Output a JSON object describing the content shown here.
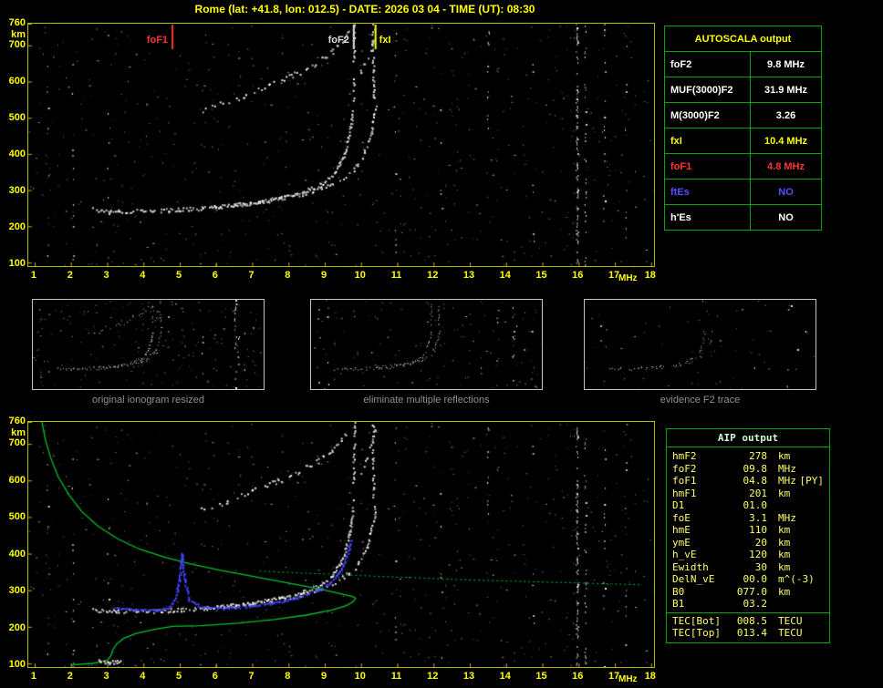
{
  "title": "Rome (lat: +41.8, lon: 012.5) - DATE: 2026 03 04 - TIME (UT): 08:30",
  "colors": {
    "background": "#000000",
    "title": "#ffff00",
    "plot_border": "#b8b800",
    "axis_label": "#ffff00",
    "table_border": "#00aa00",
    "caption_gray": "#909090",
    "thumb_border": "#c4c4c4",
    "profile_green": "#00c030",
    "trace_blue": "#4545ff",
    "marker_red": "#ff3535",
    "marker_white": "#e0e0e0",
    "marker_yellow": "#ffff00",
    "aip_text": "#ffff66",
    "aip_header": "#ccffcc"
  },
  "top_plot": {
    "y_unit": "km",
    "x_unit": "MHz",
    "y_ticks": [
      760,
      700,
      600,
      500,
      400,
      300,
      200,
      100
    ],
    "x_ticks": [
      1,
      2,
      3,
      4,
      5,
      6,
      7,
      8,
      9,
      10,
      11,
      12,
      13,
      14,
      15,
      16,
      17,
      18
    ],
    "markers": [
      {
        "label": "foF1",
        "freq": 4.8,
        "color": "#ff3535",
        "side": "left"
      },
      {
        "label": "foF2",
        "freq": 9.8,
        "color": "#e0e0e0",
        "side": "left"
      },
      {
        "label": "fxI",
        "freq": 10.4,
        "color": "#ffff00",
        "side": "right"
      }
    ]
  },
  "bottom_plot": {
    "y_unit": "km",
    "x_unit": "MHz",
    "y_ticks": [
      760,
      700,
      600,
      500,
      400,
      300,
      200,
      100
    ],
    "x_ticks": [
      1,
      2,
      3,
      4,
      5,
      6,
      7,
      8,
      9,
      10,
      11,
      12,
      13,
      14,
      15,
      16,
      17,
      18
    ]
  },
  "autoscala_table": {
    "header": "AUTOSCALA output",
    "rows": [
      {
        "label": "foF2",
        "value": "9.8 MHz",
        "color": "#ffffff"
      },
      {
        "label": "MUF(3000)F2",
        "value": "31.9 MHz",
        "color": "#ffffff"
      },
      {
        "label": "M(3000)F2",
        "value": "3.26",
        "color": "#ffffff"
      },
      {
        "label": "fxI",
        "value": "10.4 MHz",
        "color": "#ffff00"
      },
      {
        "label": "foF1",
        "value": "4.8 MHz",
        "color": "#ff3535"
      },
      {
        "label": "ftEs",
        "value": "NO",
        "color": "#5050ff"
      },
      {
        "label": "h'Es",
        "value": "NO",
        "color": "#ffffff"
      }
    ]
  },
  "thumbnails": [
    {
      "caption": "original ionogram resized"
    },
    {
      "caption": "eliminate multiple reflections"
    },
    {
      "caption": "evidence F2 trace"
    }
  ],
  "aip_table": {
    "header": "AIP output",
    "rows": [
      {
        "label": "hmF2",
        "value": "278",
        "unit": "km"
      },
      {
        "label": "foF2",
        "value": "09.8",
        "unit": "MHz"
      },
      {
        "label": "foF1",
        "value": "04.8",
        "unit": "MHz",
        "extra": "[PY]"
      },
      {
        "label": "hmF1",
        "value": "201",
        "unit": "km"
      },
      {
        "label": "D1",
        "value": "01.0",
        "unit": ""
      },
      {
        "label": "foE",
        "value": "3.1",
        "unit": "MHz"
      },
      {
        "label": "hmE",
        "value": "110",
        "unit": "km"
      },
      {
        "label": "ymE",
        "value": "20",
        "unit": "km"
      },
      {
        "label": "h_vE",
        "value": "120",
        "unit": "km"
      },
      {
        "label": "Ewidth",
        "value": "30",
        "unit": "km"
      },
      {
        "label": "DelN_vE",
        "value": "00.0",
        "unit": "m^(-3)"
      },
      {
        "label": "B0",
        "value": "077.0",
        "unit": "km"
      },
      {
        "label": "B1",
        "value": "03.2",
        "unit": ""
      },
      {
        "label": "TEC[Bot]",
        "value": "008.5",
        "unit": "TECU",
        "separator_above": true
      },
      {
        "label": "TEC[Top]",
        "value": "013.4",
        "unit": "TECU"
      }
    ]
  },
  "chart_data": {
    "type": "scatter",
    "title": "ionogram virtual height vs frequency",
    "x_label": "MHz",
    "y_label": "km",
    "x_range": [
      0.824,
      18.08
    ],
    "h_range": [
      90,
      760
    ],
    "speckle": {
      "count": 650
    },
    "rfi_columns": [
      {
        "f": 1.35,
        "density": 0.05
      },
      {
        "f": 2.05,
        "density": 0.11
      },
      {
        "f": 3.02,
        "density": 0.04
      },
      {
        "f": 10.95,
        "density": 0.09
      },
      {
        "f": 12.2,
        "density": 0.05
      },
      {
        "f": 13.5,
        "density": 0.1
      },
      {
        "f": 14.75,
        "density": 0.05
      },
      {
        "f": 15.95,
        "density": 0.42
      },
      {
        "f": 16.18,
        "density": 0.2
      },
      {
        "f": 16.7,
        "density": 0.08
      },
      {
        "f": 17.3,
        "density": 0.06
      }
    ],
    "traces": [
      {
        "name": "f2-o-mode",
        "dot": 2,
        "jitter": 2,
        "density": 0.85,
        "points": [
          [
            2.6,
            248
          ],
          [
            3.3,
            243
          ],
          [
            4.2,
            244
          ],
          [
            5.0,
            248
          ],
          [
            6.0,
            255
          ],
          [
            7.0,
            266
          ],
          [
            7.8,
            280
          ],
          [
            8.4,
            297
          ],
          [
            8.9,
            318
          ],
          [
            9.2,
            344
          ],
          [
            9.4,
            374
          ],
          [
            9.55,
            408
          ],
          [
            9.65,
            448
          ],
          [
            9.72,
            490
          ],
          [
            9.76,
            525
          ]
        ]
      },
      {
        "name": "f2-x-mode",
        "dot": 2,
        "jitter": 2,
        "density": 0.6,
        "points": [
          [
            5.5,
            250
          ],
          [
            6.5,
            259
          ],
          [
            7.5,
            272
          ],
          [
            8.3,
            288
          ],
          [
            8.9,
            307
          ],
          [
            9.4,
            330
          ],
          [
            9.8,
            358
          ],
          [
            10.0,
            388
          ],
          [
            10.15,
            422
          ],
          [
            10.27,
            462
          ],
          [
            10.35,
            505
          ],
          [
            10.39,
            540
          ]
        ]
      },
      {
        "name": "second-hop",
        "dot": 2,
        "jitter": 3,
        "density": 0.42,
        "points": [
          [
            5.6,
            520
          ],
          [
            6.3,
            545
          ],
          [
            7.0,
            572
          ],
          [
            7.7,
            600
          ],
          [
            8.3,
            628
          ],
          [
            8.8,
            655
          ],
          [
            9.2,
            685
          ],
          [
            9.5,
            715
          ],
          [
            9.65,
            740
          ]
        ]
      },
      {
        "name": "second-hop-x",
        "dot": 2,
        "jitter": 2,
        "density": 0.35,
        "points": [
          [
            9.95,
            620
          ],
          [
            10.15,
            665
          ],
          [
            10.3,
            710
          ],
          [
            10.38,
            745
          ]
        ]
      },
      {
        "name": "asymptote-streak-o",
        "dot": 2,
        "jitter": 1,
        "density": 0.35,
        "points": [
          [
            9.78,
            545
          ],
          [
            9.8,
            758
          ]
        ]
      },
      {
        "name": "asymptote-streak-x",
        "dot": 2,
        "jitter": 1,
        "density": 0.55,
        "points": [
          [
            10.33,
            555
          ],
          [
            10.31,
            758
          ]
        ]
      }
    ],
    "bottom_overlays": {
      "profile_color": "#00c030",
      "profile": [
        [
          1.2,
          760
        ],
        [
          1.3,
          710
        ],
        [
          1.45,
          660
        ],
        [
          1.65,
          610
        ],
        [
          1.95,
          560
        ],
        [
          2.3,
          515
        ],
        [
          2.75,
          475
        ],
        [
          3.3,
          440
        ],
        [
          3.9,
          412
        ],
        [
          4.6,
          390
        ],
        [
          5.3,
          372
        ],
        [
          6.1,
          355
        ],
        [
          6.9,
          340
        ],
        [
          7.7,
          325
        ],
        [
          8.4,
          312
        ],
        [
          9.0,
          300
        ],
        [
          9.5,
          289
        ],
        [
          9.78,
          282
        ],
        [
          9.85,
          278
        ],
        [
          9.8,
          270
        ],
        [
          9.6,
          258
        ],
        [
          9.2,
          246
        ],
        [
          8.5,
          232
        ],
        [
          7.6,
          220
        ],
        [
          6.6,
          210
        ],
        [
          5.6,
          203
        ],
        [
          4.8,
          201
        ],
        [
          4.3,
          193
        ],
        [
          3.8,
          182
        ],
        [
          3.45,
          168
        ],
        [
          3.25,
          152
        ],
        [
          3.15,
          136
        ],
        [
          3.1,
          120
        ],
        [
          3.0,
          108
        ],
        [
          2.6,
          100
        ],
        [
          2.0,
          96
        ]
      ],
      "dotted_line": [
        [
          7.2,
          352
        ],
        [
          10.0,
          340
        ],
        [
          13.0,
          328
        ],
        [
          17.7,
          315
        ]
      ],
      "blue_color": "#4545ff",
      "blue_trace": [
        [
          3.2,
          252
        ],
        [
          3.9,
          247
        ],
        [
          4.4,
          247
        ],
        [
          4.7,
          255
        ],
        [
          4.88,
          280
        ],
        [
          4.98,
          330
        ],
        [
          5.05,
          400
        ],
        [
          5.12,
          330
        ],
        [
          5.25,
          275
        ],
        [
          5.6,
          255
        ],
        [
          6.2,
          252
        ],
        [
          7.0,
          257
        ],
        [
          7.7,
          268
        ],
        [
          8.3,
          282
        ],
        [
          8.8,
          300
        ],
        [
          9.15,
          322
        ],
        [
          9.4,
          350
        ],
        [
          9.55,
          380
        ],
        [
          9.65,
          410
        ],
        [
          9.72,
          438
        ]
      ],
      "e_echo": [
        [
          2.75,
          108
        ],
        [
          3.05,
          104
        ],
        [
          3.35,
          108
        ]
      ]
    }
  }
}
